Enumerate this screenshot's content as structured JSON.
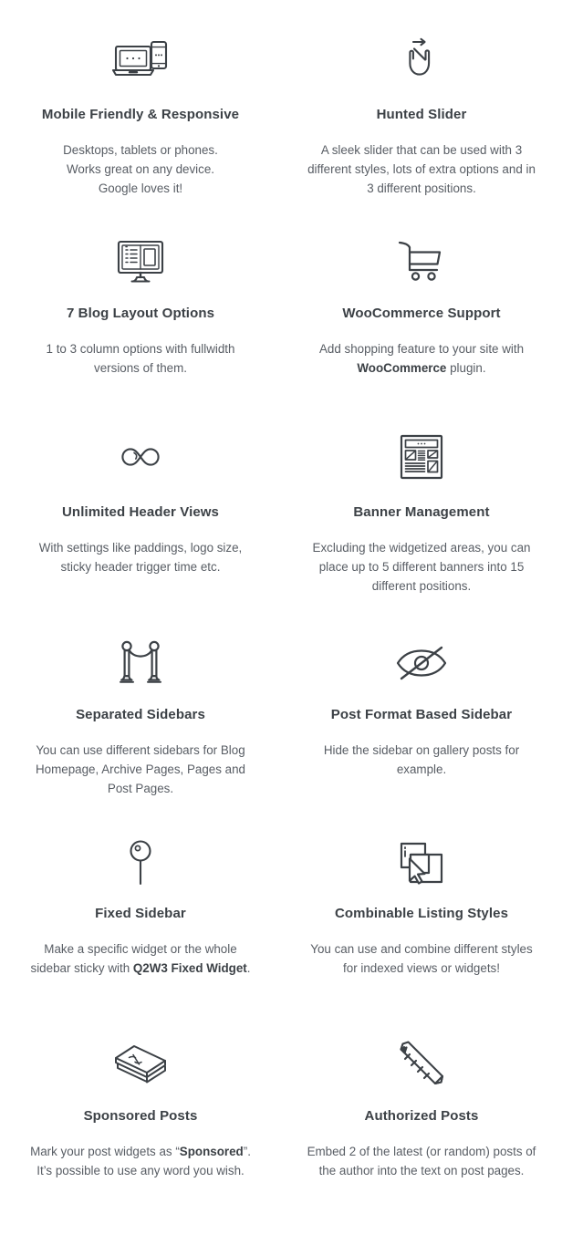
{
  "page": {
    "background_color": "#ffffff",
    "title_color": "#3c4146",
    "text_color": "#585d64",
    "icon_color": "#3c4146"
  },
  "features": [
    {
      "icon": "laptop-phone-icon",
      "title": "Mobile Friendly & Responsive",
      "desc_lines": [
        "Desktops, tablets or phones.",
        "Works great on any device.",
        "Google loves it!"
      ],
      "desc_html": "Desktops, tablets or phones.<br>Works great on any device.<br>Google loves it!"
    },
    {
      "icon": "swipe-hand-icon",
      "title": "Hunted Slider",
      "desc_lines": [
        "A sleek slider that can be used with",
        "3 different styles, lots of extra",
        "options and in 3 different positions."
      ],
      "desc_html": "A sleek slider that can be used with 3 different styles, lots of extra options and in 3 different positions."
    },
    {
      "icon": "monitor-layout-icon",
      "title": "7 Blog Layout Options",
      "desc_lines": [
        "1 to 3 column options with fullwidth",
        "versions of them."
      ],
      "desc_html": "1 to 3 column options with fullwidth versions of them."
    },
    {
      "icon": "shopping-cart-icon",
      "title": "WooCommerce Support",
      "desc_lines": [
        "Add shopping feature to your site",
        "with WooCommerce plugin."
      ],
      "desc_html": "Add shopping feature to your site with <b>WooCommerce</b> plugin."
    },
    {
      "icon": "infinity-icon",
      "title": "Unlimited Header Views",
      "desc_lines": [
        "With settings like paddings, logo",
        "size, sticky header trigger time etc."
      ],
      "desc_html": "With settings like paddings, logo size, sticky header trigger time etc."
    },
    {
      "icon": "newspaper-layout-icon",
      "title": "Banner Management",
      "desc_lines": [
        "Excluding the widgetized areas,",
        "you can place up to 5 different",
        "banners into 15 different positions."
      ],
      "desc_html": "Excluding the widgetized areas, you can place up to 5 different banners into 15 different positions."
    },
    {
      "icon": "velvet-rope-barrier-icon",
      "title": "Separated Sidebars",
      "desc_lines": [
        "You can use different sidebars for",
        "Blog Homepage, Archive Pages,",
        "Pages and Post Pages."
      ],
      "desc_html": "You can use different sidebars for Blog Homepage, Archive Pages, Pages and Post Pages."
    },
    {
      "icon": "eye-slash-icon",
      "title": "Post Format Based Sidebar",
      "desc_lines": [
        "Hide the sidebar on gallery posts",
        "for example."
      ],
      "desc_html": "Hide the sidebar on gallery posts for example."
    },
    {
      "icon": "push-pin-icon",
      "title": "Fixed Sidebar",
      "desc_lines": [
        "Make a specific widget or the",
        "whole sidebar sticky with Q2W3",
        "Fixed Widget."
      ],
      "desc_html": "Make a specific widget or the whole sidebar sticky with <b>Q2W3 Fixed Widget</b>."
    },
    {
      "icon": "overlapping-windows-cursor-icon",
      "title": "Combinable Listing Styles",
      "desc_lines": [
        "You can use and combine different",
        "styles for indexed views or",
        "widgets!"
      ],
      "desc_html": "You can use and combine different styles for indexed views or widgets!"
    },
    {
      "icon": "money-stack-icon",
      "title": "Sponsored Posts",
      "desc_lines": [
        "Mark your post widgets as",
        "“Sponsored”. It’s possible to use",
        "any word you wish."
      ],
      "desc_html": "Mark your post widgets as “<b>Sponsored</b>”. It’s possible to use any word you wish."
    },
    {
      "icon": "pen-icon",
      "title": "Authorized Posts",
      "desc_lines": [
        "Embed 2 of the latest (or random)",
        "posts of the author into the text on",
        "post pages."
      ],
      "desc_html": "Embed 2 of the latest (or random) posts of the author into the text on post pages."
    }
  ]
}
